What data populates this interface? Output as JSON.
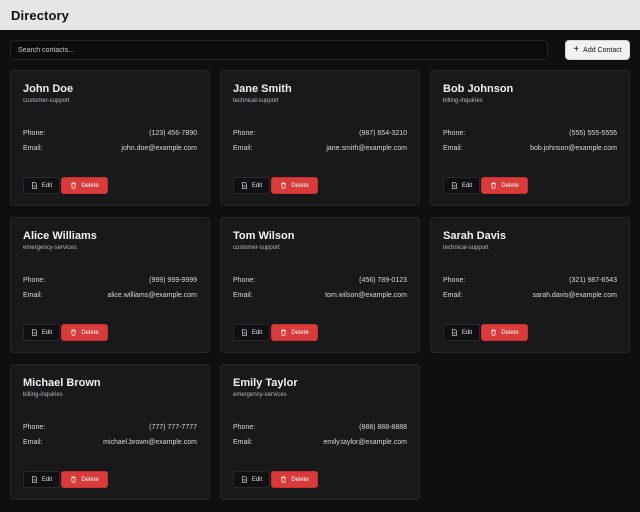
{
  "header": {
    "title": "Directory"
  },
  "toolbar": {
    "search_placeholder": "Search contacts...",
    "add_label": "Add Contact"
  },
  "labels": {
    "phone": "Phone:",
    "email": "Email:",
    "edit": "Edit",
    "delete": "Delete"
  },
  "colors": {
    "accent_delete": "#d93b3b",
    "card_bg": "#19191b",
    "page_bg": "#0f0f10"
  },
  "contacts": [
    {
      "name": "John Doe",
      "department": "customer-support",
      "phone": "(123) 456-7890",
      "email": "john.doe@example.com"
    },
    {
      "name": "Jane Smith",
      "department": "technical-support",
      "phone": "(987) 654-3210",
      "email": "jane.smith@example.com"
    },
    {
      "name": "Bob Johnson",
      "department": "billing-inquiries",
      "phone": "(555) 555-5555",
      "email": "bob.johnson@example.com"
    },
    {
      "name": "Alice Williams",
      "department": "emergency-services",
      "phone": "(999) 999-9999",
      "email": "alice.williams@example.com"
    },
    {
      "name": "Tom Wilson",
      "department": "customer-support",
      "phone": "(456) 789-0123",
      "email": "tom.wilson@example.com"
    },
    {
      "name": "Sarah Davis",
      "department": "technical-support",
      "phone": "(321) 987-6543",
      "email": "sarah.davis@example.com"
    },
    {
      "name": "Michael Brown",
      "department": "billing-inquiries",
      "phone": "(777) 777-7777",
      "email": "michael.brown@example.com"
    },
    {
      "name": "Emily Taylor",
      "department": "emergency-services",
      "phone": "(888) 888-8888",
      "email": "emily.taylor@example.com"
    }
  ]
}
